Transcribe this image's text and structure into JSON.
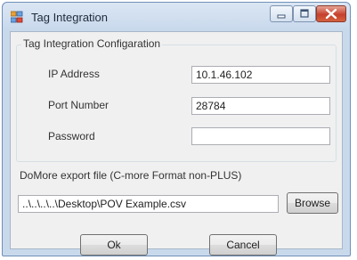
{
  "window": {
    "title": "Tag Integration"
  },
  "group": {
    "title": "Tag Integration Configaration",
    "ip_label": "IP Address",
    "ip_value": "10.1.46.102",
    "port_label": "Port Number",
    "port_value": "28784",
    "password_label": "Password",
    "password_value": ""
  },
  "export": {
    "label": "DoMore export file (C-more Format non-PLUS)",
    "path_value": "..\\..\\..\\..\\Desktop\\POV Example.csv",
    "browse_label": "Browse"
  },
  "buttons": {
    "ok_label": "Ok",
    "cancel_label": "Cancel"
  },
  "icons": {
    "app": "tag-integration-app-icon",
    "minimize": "minimize-icon",
    "maximize": "maximize-icon",
    "close": "close-icon"
  },
  "colors": {
    "close_button": "#c6402c",
    "title_bar": "#c9d9ec",
    "dialog_body": "#f0f0f0"
  }
}
